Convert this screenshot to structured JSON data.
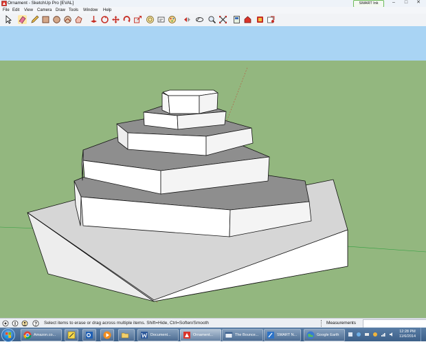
{
  "window": {
    "title": "Ornament - SketchUp Pro [EVAL]"
  },
  "smart_ink": {
    "label": "SMART Ink"
  },
  "window_controls": {
    "minimize": "–",
    "maximize": "□",
    "close": "✕"
  },
  "menu": {
    "items": [
      "File",
      "Edit",
      "View",
      "Camera",
      "Draw",
      "Tools",
      "Window",
      "Help"
    ]
  },
  "toolbar": {
    "tools": [
      "select-icon",
      "eraser-icon",
      "pencil-icon",
      "rectangle-icon",
      "circle-icon",
      "arc-icon",
      "polygon-icon",
      "push-pull-icon",
      "follow-me-icon",
      "move-icon",
      "rotate-icon",
      "scale-icon",
      "offset-icon",
      "tape-measure-icon",
      "text-icon",
      "paint-bucket-icon",
      "orbit-icon",
      "pan-icon",
      "zoom-icon",
      "zoom-extents-icon",
      "warehouse-icon",
      "share-model-icon",
      "extension-icon",
      "extension-warehouse-icon"
    ]
  },
  "status": {
    "text": "Select items to erase or drag across multiple items. Shift=Hide, Ctrl=Soften/Smooth",
    "measurements_label": "Measurements",
    "measurements_value": ""
  },
  "taskbar": {
    "buttons": [
      {
        "icon": "chrome-icon",
        "label": "Amazon.co..."
      },
      {
        "icon": "notes-icon",
        "label": ""
      },
      {
        "icon": "outlook-icon",
        "label": ""
      },
      {
        "icon": "media-player-icon",
        "label": ""
      },
      {
        "icon": "folder-icon",
        "label": ""
      },
      {
        "icon": "word-icon",
        "label": "Document..."
      },
      {
        "icon": "sketchup-icon",
        "label": "Ornament..."
      },
      {
        "icon": "browser-icon",
        "label": "The Bounce..."
      },
      {
        "icon": "smart-notebook-icon",
        "label": "SMART N..."
      },
      {
        "icon": "google-earth-icon",
        "label": "Google Earth"
      }
    ],
    "clock_time": "12:28 PM",
    "clock_date": "11/6/2014"
  },
  "colors": {
    "sky": "#a9d4f4",
    "ground": "#93b77f",
    "face_light": "#ffffff",
    "face_shade": "#e4e4e4",
    "face_dark": "#8e8e8e",
    "edge": "#111111",
    "axis_red": "#c0392b",
    "axis_green": "#2e9e3e"
  }
}
